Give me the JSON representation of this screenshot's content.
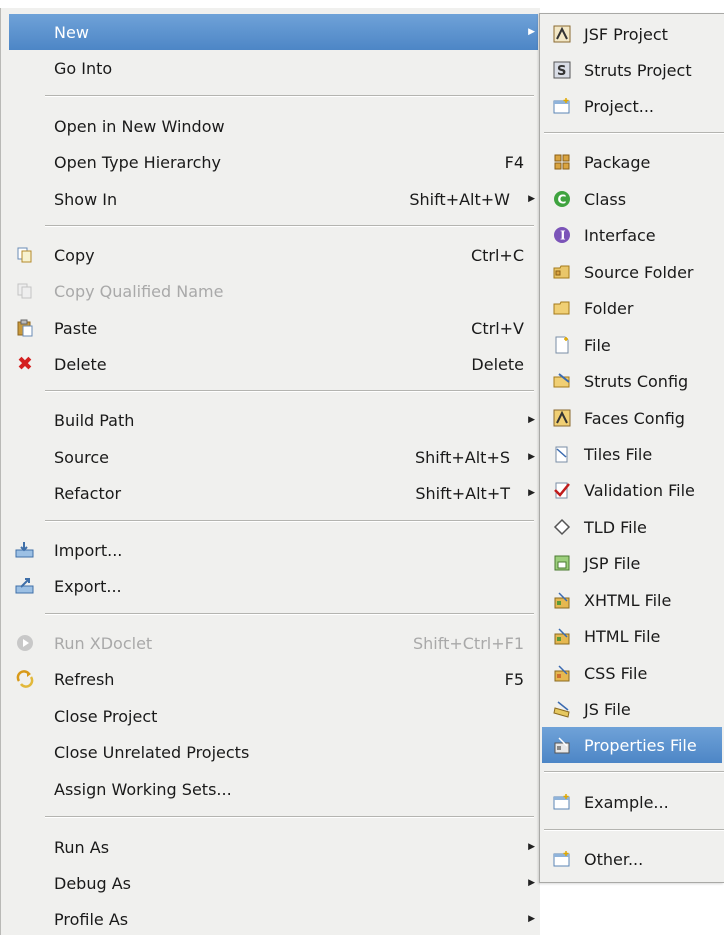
{
  "main_menu": {
    "items": [
      {
        "label": "New",
        "shortcut": "",
        "submenu": true,
        "highlighted": true
      },
      {
        "label": "Go Into",
        "shortcut": ""
      },
      {
        "label": "Open in New Window",
        "shortcut": ""
      },
      {
        "label": "Open Type Hierarchy",
        "shortcut": "F4"
      },
      {
        "label": "Show In",
        "shortcut": "Shift+Alt+W",
        "submenu": true
      },
      {
        "label": "Copy",
        "shortcut": "Ctrl+C",
        "icon": "copy-icon"
      },
      {
        "label": "Copy Qualified Name",
        "shortcut": "",
        "icon": "copy-icon",
        "disabled": true
      },
      {
        "label": "Paste",
        "shortcut": "Ctrl+V",
        "icon": "paste-icon"
      },
      {
        "label": "Delete",
        "shortcut": "Delete",
        "icon": "delete-icon"
      },
      {
        "label": "Build Path",
        "shortcut": "",
        "submenu": true
      },
      {
        "label": "Source",
        "shortcut": "Shift+Alt+S",
        "submenu": true
      },
      {
        "label": "Refactor",
        "shortcut": "Shift+Alt+T",
        "submenu": true
      },
      {
        "label": "Import...",
        "shortcut": "",
        "icon": "import-icon"
      },
      {
        "label": "Export...",
        "shortcut": "",
        "icon": "export-icon"
      },
      {
        "label": "Run XDoclet",
        "shortcut": "Shift+Ctrl+F1",
        "icon": "run-icon",
        "disabled": true
      },
      {
        "label": "Refresh",
        "shortcut": "F5",
        "icon": "refresh-icon"
      },
      {
        "label": "Close Project",
        "shortcut": ""
      },
      {
        "label": "Close Unrelated Projects",
        "shortcut": ""
      },
      {
        "label": "Assign Working Sets...",
        "shortcut": ""
      },
      {
        "label": "Run As",
        "shortcut": "",
        "submenu": true
      },
      {
        "label": "Debug As",
        "shortcut": "",
        "submenu": true
      },
      {
        "label": "Profile As",
        "shortcut": "",
        "submenu": true
      }
    ]
  },
  "new_submenu": {
    "items": [
      {
        "label": "JSF Project",
        "icon": "jsf-project-icon"
      },
      {
        "label": "Struts Project",
        "icon": "struts-project-icon"
      },
      {
        "label": "Project...",
        "icon": "project-icon"
      },
      {
        "label": "Package",
        "icon": "package-icon"
      },
      {
        "label": "Class",
        "icon": "class-icon"
      },
      {
        "label": "Interface",
        "icon": "interface-icon"
      },
      {
        "label": "Source Folder",
        "icon": "source-folder-icon"
      },
      {
        "label": "Folder",
        "icon": "folder-icon"
      },
      {
        "label": "File",
        "icon": "file-icon"
      },
      {
        "label": "Struts Config",
        "icon": "struts-config-icon"
      },
      {
        "label": "Faces Config",
        "icon": "faces-config-icon"
      },
      {
        "label": "Tiles File",
        "icon": "tiles-file-icon"
      },
      {
        "label": "Validation File",
        "icon": "validation-file-icon"
      },
      {
        "label": "TLD File",
        "icon": "tld-file-icon"
      },
      {
        "label": "JSP File",
        "icon": "jsp-file-icon"
      },
      {
        "label": "XHTML File",
        "icon": "xhtml-file-icon"
      },
      {
        "label": "HTML File",
        "icon": "html-file-icon"
      },
      {
        "label": "CSS File",
        "icon": "css-file-icon"
      },
      {
        "label": "JS File",
        "icon": "js-file-icon"
      },
      {
        "label": "Properties File",
        "icon": "properties-file-icon",
        "highlighted": true
      },
      {
        "label": "Example...",
        "icon": "example-icon"
      },
      {
        "label": "Other...",
        "icon": "other-icon"
      }
    ]
  },
  "colors": {
    "menu_bg": "#f0f0ee",
    "highlight": "#4d86c6",
    "disabled_text": "#a9a9a9",
    "delete_red": "#d42020"
  }
}
